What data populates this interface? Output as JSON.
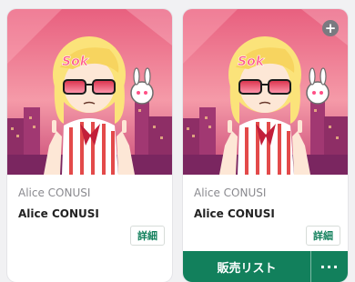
{
  "cards": [
    {
      "collection": "Alice CONUSI",
      "name": "Alice CONUSI",
      "detail_label": "詳細"
    },
    {
      "collection": "Alice CONUSI",
      "name": "Alice CONUSI",
      "detail_label": "詳細",
      "add_icon": "+",
      "sale_label": "販売リスト",
      "more_label": "···"
    }
  ],
  "colors": {
    "accent": "#12805c",
    "art_sky": "#f06e86"
  }
}
